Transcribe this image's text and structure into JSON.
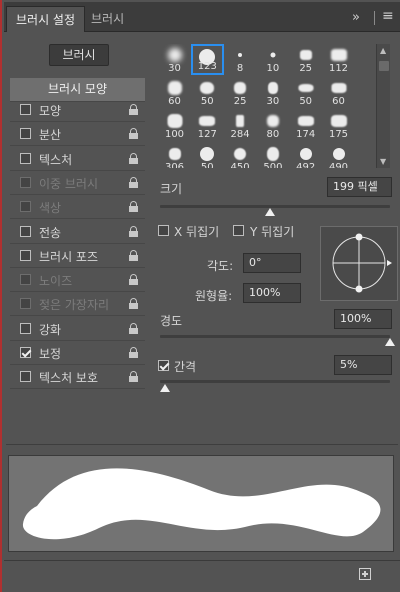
{
  "tabs": [
    {
      "label": "브러시 설정"
    },
    {
      "label": "브러시"
    }
  ],
  "header_icons": {
    "expand": "»",
    "menu": "≡"
  },
  "brushes_button": "브러시",
  "options_header": "브러시 모양",
  "options": [
    {
      "label": "모양",
      "checked": false,
      "enabled": true
    },
    {
      "label": "분산",
      "checked": false,
      "enabled": true
    },
    {
      "label": "텍스처",
      "checked": false,
      "enabled": true
    },
    {
      "label": "이중 브러시",
      "checked": false,
      "enabled": false
    },
    {
      "label": "색상",
      "checked": false,
      "enabled": false
    },
    {
      "label": "전송",
      "checked": false,
      "enabled": true
    },
    {
      "label": "브러시 포즈",
      "checked": false,
      "enabled": true
    },
    {
      "label": "노이즈",
      "checked": false,
      "enabled": false
    },
    {
      "label": "젖은 가장자리",
      "checked": false,
      "enabled": false
    },
    {
      "label": "강화",
      "checked": false,
      "enabled": true
    },
    {
      "label": "보정",
      "checked": true,
      "enabled": true
    },
    {
      "label": "텍스처 보호",
      "checked": false,
      "enabled": true
    }
  ],
  "tips": [
    "30",
    "123",
    "8",
    "10",
    "25",
    "112",
    "60",
    "50",
    "25",
    "30",
    "50",
    "60",
    "100",
    "127",
    "284",
    "80",
    "174",
    "175",
    "306",
    "50",
    "450",
    "500",
    "492",
    "490"
  ],
  "tips_selected_index": 1,
  "size": {
    "label": "크기",
    "value": "199 픽셀",
    "slider_fraction": 0.48
  },
  "flip_x": {
    "label": "X 뒤집기",
    "checked": false
  },
  "flip_y": {
    "label": "Y 뒤집기",
    "checked": false
  },
  "angle": {
    "label": "각도:",
    "value": "0°"
  },
  "roundness": {
    "label": "원형율:",
    "value": "100%"
  },
  "hardness": {
    "label": "경도",
    "value": "100%",
    "slider_fraction": 1.0
  },
  "spacing": {
    "label": "간격",
    "value": "5%",
    "checked": true,
    "slider_fraction": 0.02
  },
  "colors": {
    "panel": "#535353",
    "selection": "#2a8ff0",
    "preview_bg": "#737373"
  }
}
